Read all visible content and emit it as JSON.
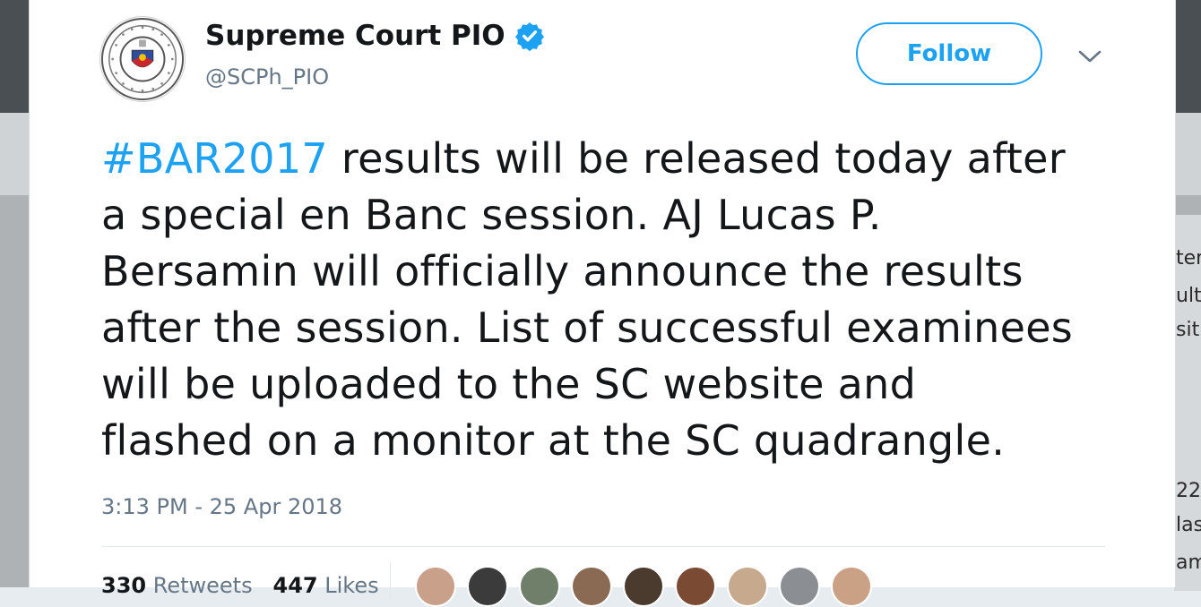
{
  "background": {
    "right_snippets": [
      "ter",
      "ult",
      "sit",
      "22",
      "las",
      "am"
    ]
  },
  "tweet": {
    "author": {
      "name": "Supreme Court PIO",
      "handle": "@SCPh_PIO",
      "verified": true,
      "avatar_icon": "supreme-court-seal-icon",
      "avatar_seal_text": "SUPREME COURT · REPUBLIC OF THE PHILIPPINES"
    },
    "follow_label": "Follow",
    "menu_icon": "chevron-down-icon",
    "hashtag": "#BAR2017",
    "text_lines": [
      " results will be released today after",
      "a special en Banc session. AJ Lucas P.",
      "Bersamin will officially announce the results",
      "after the session. List of successful examinees",
      "will be uploaded to the SC website and",
      "flashed on a monitor at the SC quadrangle."
    ],
    "timestamp": "3:13 PM - 25 Apr 2018",
    "stats": {
      "retweets_count": "330",
      "retweets_label": "Retweets",
      "likes_count": "447",
      "likes_label": "Likes"
    },
    "liker_avatar_colors": [
      "#c9a08a",
      "#3b3b3b",
      "#6f7f6a",
      "#8a6a52",
      "#4b3a2e",
      "#7a4a33",
      "#c7a98e",
      "#8b8f93",
      "#caa184"
    ]
  },
  "colors": {
    "accent": "#1da1f2",
    "text": "#14171a",
    "secondary_text": "#657786"
  }
}
